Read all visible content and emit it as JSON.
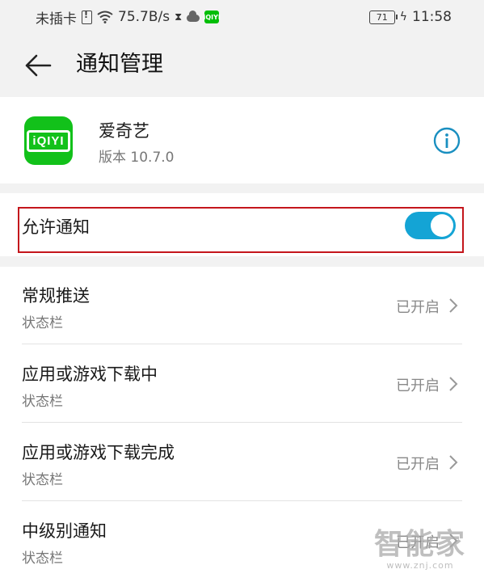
{
  "status_bar": {
    "carrier": "未插卡",
    "net_speed": "75.7B/s",
    "mini_app_label": "iQIYI",
    "battery": "71",
    "time": "11:58"
  },
  "header": {
    "title": "通知管理"
  },
  "app_info": {
    "name": "爱奇艺",
    "version": "版本 10.7.0",
    "icon_text": "iQIYI",
    "brand_color": "#12c11a"
  },
  "allow_notifications": {
    "label": "允许通知",
    "enabled": true,
    "accent_color": "#14a4d5"
  },
  "channels": [
    {
      "title": "常规推送",
      "subtitle": "状态栏",
      "status": "已开启"
    },
    {
      "title": "应用或游戏下载中",
      "subtitle": "状态栏",
      "status": "已开启"
    },
    {
      "title": "应用或游戏下载完成",
      "subtitle": "状态栏",
      "status": "已开启"
    },
    {
      "title": "中级别通知",
      "subtitle": "状态栏",
      "status": "已开启"
    }
  ],
  "watermark": {
    "main": "智能家",
    "url": "www.znj.com"
  }
}
